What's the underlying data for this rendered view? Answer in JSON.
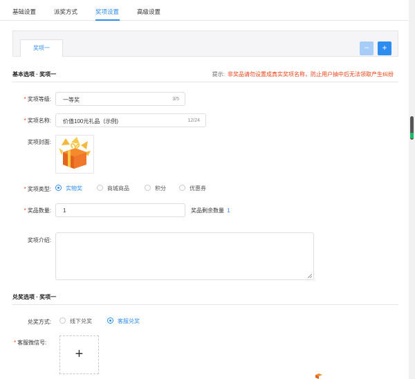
{
  "tabs": [
    {
      "label": "基础设置"
    },
    {
      "label": "派奖方式"
    },
    {
      "label": "奖项设置"
    },
    {
      "label": "高级设置"
    }
  ],
  "prize_tabs": [
    {
      "label": "奖项一"
    }
  ],
  "prize_actions": {
    "minus": "−",
    "plus": "+"
  },
  "basic_section": {
    "title": "基本选项 · 奖项一",
    "tip_label": "提示:",
    "tip_text": "非奖品请勿设置成真实奖项名称，防止用户抽中后无法领取产生纠纷"
  },
  "form": {
    "level": {
      "label": "奖项等级:",
      "value": "一等奖",
      "count": "3/5"
    },
    "name": {
      "label": "奖项名称:",
      "value": "价值100元礼品（示例)",
      "count": "12/24"
    },
    "cover": {
      "label": "奖项封面:"
    },
    "type": {
      "label": "奖项类型:",
      "options": [
        "实物奖",
        "商城商品",
        "积分",
        "优惠券"
      ],
      "selected": "实物奖"
    },
    "quantity": {
      "label": "奖品数量:",
      "value": "1",
      "remain_label": "奖品剩余数量",
      "remain_value": "1"
    },
    "intro": {
      "label": "奖项介绍:",
      "value": ""
    }
  },
  "redeem_section": {
    "title": "兑奖选项 · 奖项一",
    "method": {
      "label": "兑奖方式:",
      "options": [
        "线下兑奖",
        "客服兑奖"
      ],
      "selected": "客服兑奖"
    },
    "wechat": {
      "label": "客服微信号:",
      "upload_symbol": "+"
    }
  },
  "colors": {
    "accent": "#2d8cf0",
    "required": "#ed4014",
    "accent_light": "#a6cdf8"
  },
  "icons": [
    "gift-box-icon",
    "plus-icon",
    "minus-icon",
    "resize-handle-icon"
  ]
}
